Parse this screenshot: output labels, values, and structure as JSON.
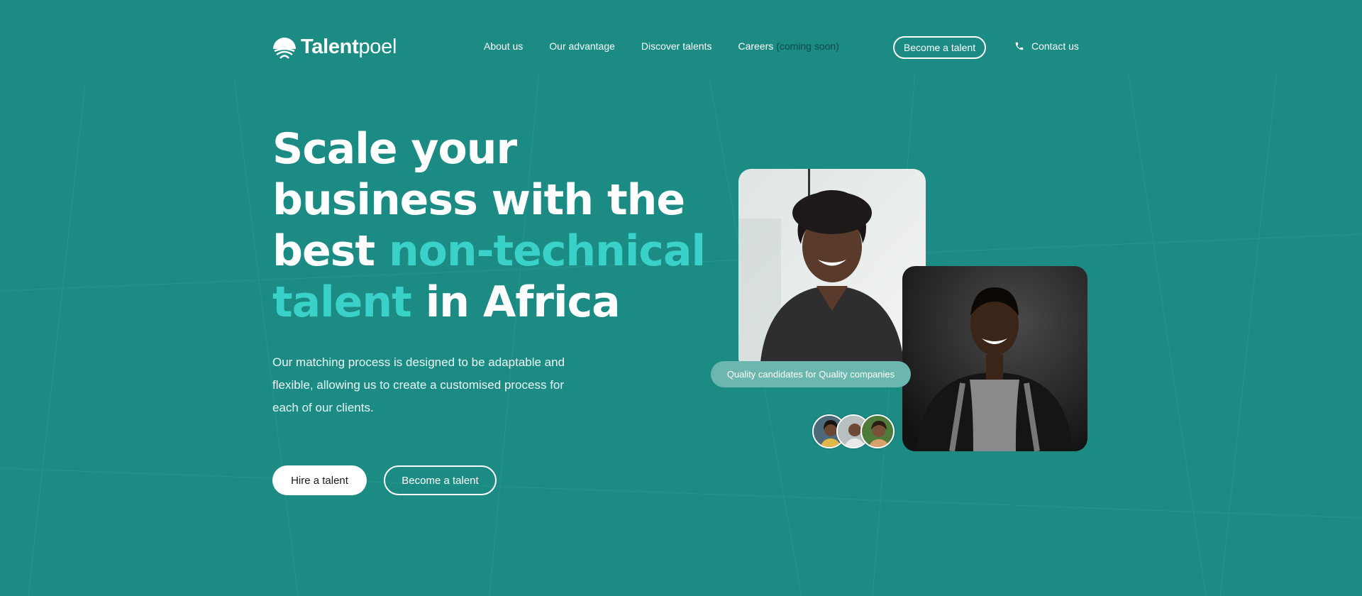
{
  "brand": {
    "name_bold": "Talent",
    "name_light": "poel"
  },
  "nav": {
    "items": [
      "About us",
      "Our advantage",
      "Discover talents"
    ],
    "careers": "Careers",
    "careers_note": "(coming soon)"
  },
  "header": {
    "become_talent": "Become a talent",
    "contact": "Contact us"
  },
  "hero": {
    "title_1": "Scale your business with the best ",
    "title_accent": "non-technical talent",
    "title_2": " in Africa",
    "description": "Our matching process is designed to be adaptable and flexible, allowing us to create a customised process for each of our clients.",
    "cta_primary": "Hire a talent",
    "cta_secondary": "Become a talent"
  },
  "showcase": {
    "tagline": "Quality candidates  for Quality companies"
  },
  "colors": {
    "background": "#1b8b83",
    "accent": "#3ad2c8",
    "muted": "#0d4a45"
  }
}
